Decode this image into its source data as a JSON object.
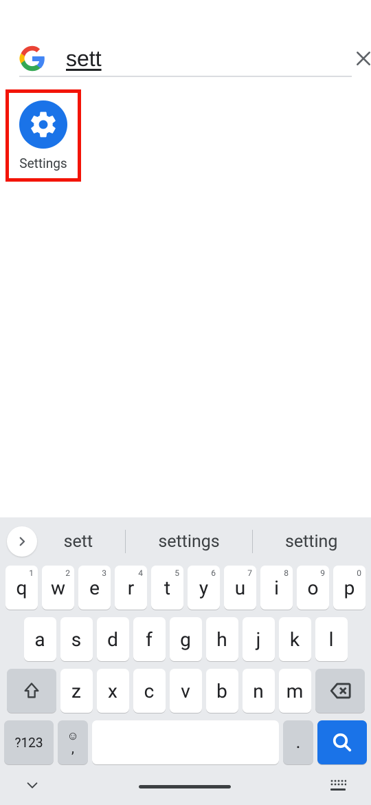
{
  "search": {
    "query": "sett",
    "clear_label": "Clear"
  },
  "results": [
    {
      "label": "Settings",
      "icon": "gear",
      "highlighted": true
    }
  ],
  "keyboard": {
    "suggestions": [
      "sett",
      "settings",
      "setting"
    ],
    "row1": [
      {
        "k": "q",
        "s": "1"
      },
      {
        "k": "w",
        "s": "2"
      },
      {
        "k": "e",
        "s": "3"
      },
      {
        "k": "r",
        "s": "4"
      },
      {
        "k": "t",
        "s": "5"
      },
      {
        "k": "y",
        "s": "6"
      },
      {
        "k": "u",
        "s": "7"
      },
      {
        "k": "i",
        "s": "8"
      },
      {
        "k": "o",
        "s": "9"
      },
      {
        "k": "p",
        "s": "0"
      }
    ],
    "row2": [
      "a",
      "s",
      "d",
      "f",
      "g",
      "h",
      "j",
      "k",
      "l"
    ],
    "row3": [
      "z",
      "x",
      "c",
      "v",
      "b",
      "n",
      "m"
    ],
    "symKey": "?123",
    "comma": ",",
    "period": "."
  }
}
